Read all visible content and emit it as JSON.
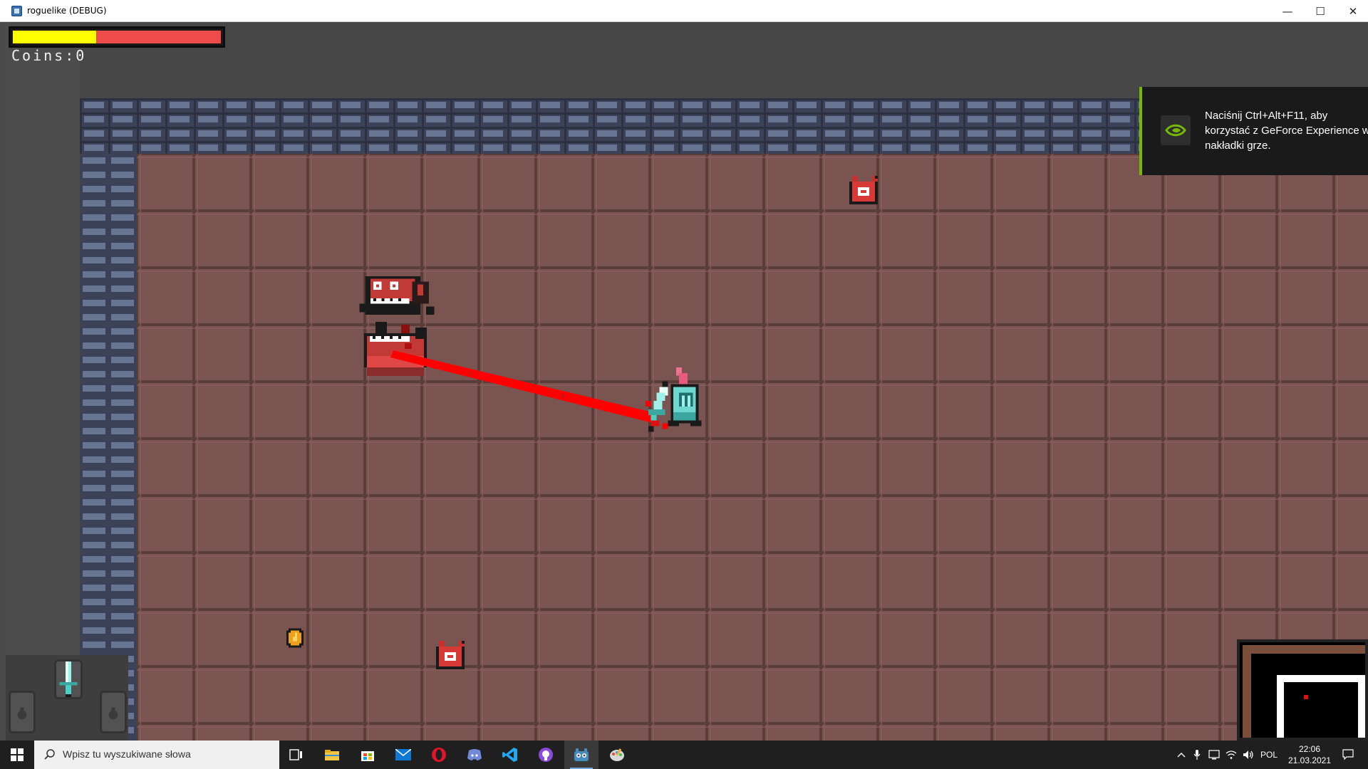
{
  "window": {
    "title": "roguelike (DEBUG)",
    "minimize_label": "—",
    "maximize_label": "☐",
    "close_label": "✕"
  },
  "hud": {
    "health_fraction": 0.4,
    "coins_label": "Coins:0"
  },
  "colors": {
    "health": "#ffff00",
    "health_missing": "#f04b4b",
    "floor": "#7a5450",
    "wall": "#3b4257",
    "laser": "#ff0000",
    "nvidia_green": "#76b900"
  },
  "overlay": {
    "message": "Naciśnij Ctrl+Alt+F11, aby korzystać z GeForce Experience w nakładki grze.",
    "icon": "nvidia-icon"
  },
  "inventory": {
    "weapon_icon": "sword-icon"
  },
  "taskbar": {
    "search_placeholder": "Wpisz tu wyszukiwane słowa",
    "apps": [
      "task-view-icon",
      "file-explorer-icon",
      "store-icon",
      "mail-icon",
      "opera-icon",
      "discord-icon",
      "vscode-icon",
      "github-icon",
      "godot-icon",
      "paint-icon"
    ],
    "language": "POL",
    "time": "22:06",
    "date": "21.03.2021"
  }
}
